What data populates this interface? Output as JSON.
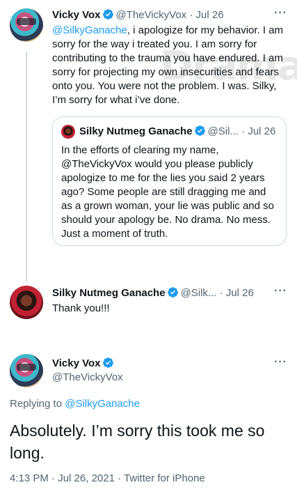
{
  "watermark": "DramaQlicious",
  "tweet1": {
    "name": "Vicky Vox",
    "handle": "@TheVickyVox",
    "separator": "·",
    "date": "Jul 26",
    "more": "···",
    "mention": "@SilkyGanache",
    "text": ", i apologize for my behavior. I am sorry for the way i treated you. I am sorry for contributing to the trauma you have endured. I am sorry for projecting my own insecurities and fears onto you. You were not the problem. I was. Silky, I’m sorry for what i’ve done."
  },
  "quote": {
    "name": "Silky Nutmeg Ganache",
    "handle": "@Sil...",
    "separator": "·",
    "date": "Jul 26",
    "text": "In the efforts of clearing my name, @TheVickyVox would you please publicly apologize to me for the lies you said 2 years ago?  Some people are still dragging me and as a grown woman, your lie was public and so should your apology be. No drama. No mess. Just a moment of truth."
  },
  "tweet2": {
    "name": "Silky Nutmeg Ganache",
    "handle": "@Silk...",
    "separator": "·",
    "date": "Jul 26",
    "more": "···",
    "text": "Thank you!!!"
  },
  "tweet3": {
    "name": "Vicky Vox",
    "handle": "@TheVickyVox",
    "more": "···",
    "replying_prefix": "Replying to ",
    "replying_to": "@SilkyGanache",
    "text": "Absolutely. I’m sorry this took me so long.",
    "time": "4:13 PM",
    "separator": "·",
    "full_date": "Jul 26, 2021",
    "source": "Twitter for iPhone"
  },
  "colors": {
    "link": "#1d9bf0",
    "secondary": "#536471",
    "border": "#cfd9de"
  }
}
